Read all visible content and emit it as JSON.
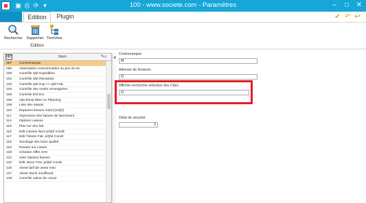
{
  "window": {
    "title": "100 - www.societe.com - Paramètres",
    "controls": {
      "minimize": "–",
      "maximize": "□",
      "close": "✕"
    }
  },
  "tabs": [
    {
      "label": ""
    },
    {
      "label": "Edition"
    },
    {
      "label": "Plugin"
    }
  ],
  "ribbon": {
    "buttons": [
      {
        "label": "Recherche",
        "icon": "search-icon"
      },
      {
        "label": "Supprimer",
        "icon": "trash-icon"
      },
      {
        "label": "TreeView",
        "icon": "treeview-icon"
      }
    ],
    "group_label": "Edition"
  },
  "grid": {
    "header": {
      "code": "087",
      "nom": "Nom"
    },
    "rows": [
      {
        "code": "087",
        "nom": "Contremarque"
      },
      {
        "code": "090",
        "nom": "Valorisation consommation au prix du lot"
      },
      {
        "code": "100",
        "nom": "Contrôle Qté Expédition"
      },
      {
        "code": "101",
        "nom": "Contrôle Qté Réception"
      },
      {
        "code": "102",
        "nom": "Contrôle Qté Exp <> Qté Fab."
      },
      {
        "code": "104",
        "nom": "Contrôle des unités renseignées"
      },
      {
        "code": "105",
        "nom": "Contrôle Ref Ext."
      },
      {
        "code": "106",
        "nom": "Opt.Simul.Mise Au Planning"
      },
      {
        "code": "109",
        "nom": "Liste des statuts"
      },
      {
        "code": "110",
        "nom": "Ruptures liasses /cde(1)/nd(2)"
      },
      {
        "code": "111",
        "nom": "Impression des liasses de lancement"
      },
      {
        "code": "114",
        "nom": "Options Liasses"
      },
      {
        "code": "115",
        "nom": "Plan sur doc fab"
      },
      {
        "code": "116",
        "nom": "Edit.Liasses lanct p/Qté Condt"
      },
      {
        "code": "117",
        "nom": "Edit.Tickets Fab. p/Qté Condt"
      },
      {
        "code": "118",
        "nom": "Stockage des bons qualité"
      },
      {
        "code": "119",
        "nom": "Dossier sur Liasse"
      },
      {
        "code": "120",
        "nom": "Création Offre SAV"
      },
      {
        "code": "121",
        "nom": "suite Options liasses"
      },
      {
        "code": "122",
        "nom": "Edit. Bons Trav. p/Qté Condt"
      },
      {
        "code": "125",
        "nom": "Alerte tarif de vente mini"
      },
      {
        "code": "127",
        "nom": "Alerte Stock insuffisant"
      },
      {
        "code": "128",
        "nom": "Contrôle valeur de conso"
      }
    ]
  },
  "form": {
    "contremarque": {
      "label": "Contremarque",
      "value": "M"
    },
    "adresse_livraison": {
      "label": "Adresse de livraison",
      "value": "O"
    },
    "recherche_selective": {
      "label": "Afficher recherche sélective des Cdes",
      "value": "O"
    },
    "delai_securite": {
      "label": "Délai de sécurité",
      "value": "2"
    }
  },
  "colors": {
    "titlebar": "#17a6d8",
    "selected_row": "#f6cc82",
    "highlight": "#e01e24"
  }
}
